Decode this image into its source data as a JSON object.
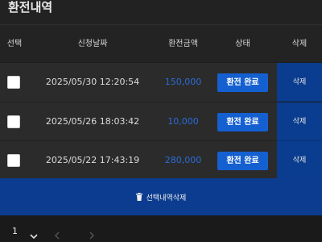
{
  "page": {
    "title": "환전내역"
  },
  "table": {
    "headers": {
      "select": "선택",
      "date": "신청날짜",
      "amount": "환전금액",
      "status": "상태",
      "delete": "삭제"
    },
    "rows": [
      {
        "date": "2025/05/30 12:20:54",
        "amount": "150,000",
        "status": "환전 완료",
        "delete": "삭제"
      },
      {
        "date": "2025/05/26 18:03:42",
        "amount": "10,000",
        "status": "환전 완료",
        "delete": "삭제"
      },
      {
        "date": "2025/05/22 17:43:19",
        "amount": "280,000",
        "status": "환전 완료",
        "delete": "삭제"
      }
    ]
  },
  "actions": {
    "delete_selected": "선택내역삭제"
  },
  "pagination": {
    "current_page": "1"
  },
  "colors": {
    "accent": "#1560d0",
    "amount": "#2a6cd8",
    "delete_bg": "#0c3c8f"
  }
}
